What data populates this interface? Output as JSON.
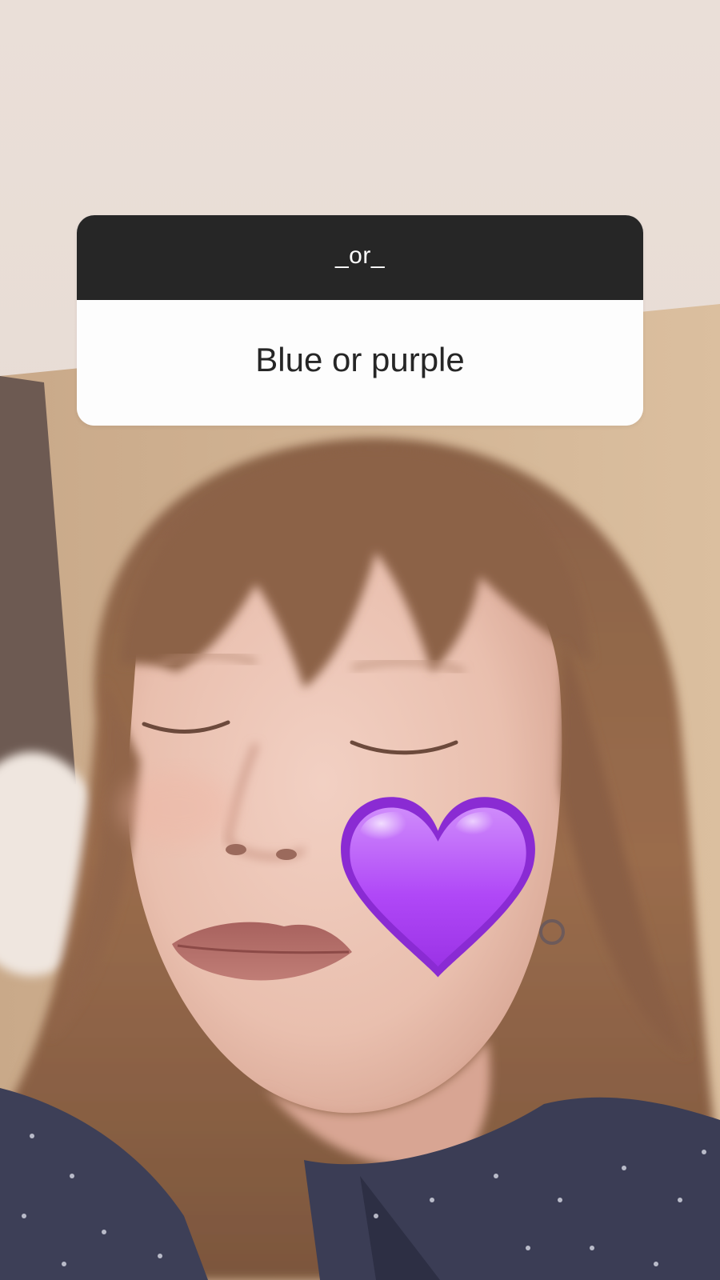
{
  "story": {
    "question_sticker": {
      "title": "_or_",
      "text": "Blue or purple"
    },
    "sticker": {
      "icon": "purple-heart-icon",
      "color": "#a844f0"
    }
  }
}
